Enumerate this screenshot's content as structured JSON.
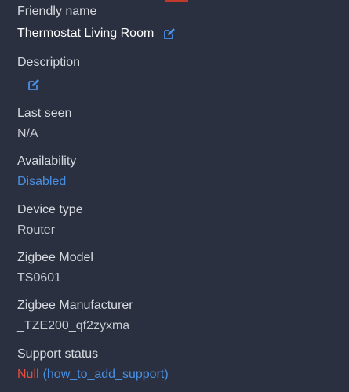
{
  "fields": {
    "friendly_name": {
      "label": "Friendly name",
      "value": "Thermostat Living Room"
    },
    "description": {
      "label": "Description",
      "value": ""
    },
    "last_seen": {
      "label": "Last seen",
      "value": "N/A"
    },
    "availability": {
      "label": "Availability",
      "value": "Disabled"
    },
    "device_type": {
      "label": "Device type",
      "value": "Router"
    },
    "zigbee_model": {
      "label": "Zigbee Model",
      "value": "TS0601"
    },
    "zigbee_manufacturer": {
      "label": "Zigbee Manufacturer",
      "value": "_TZE200_qf2zyxma"
    },
    "support_status": {
      "label": "Support status",
      "status": "Null",
      "link": "(how_to_add_support)"
    }
  },
  "icons": {
    "edit": "edit-icon"
  },
  "colors": {
    "background": "#2b3040",
    "link": "#4a90e2",
    "null": "#e74c3c",
    "accent": "#c0392b"
  }
}
